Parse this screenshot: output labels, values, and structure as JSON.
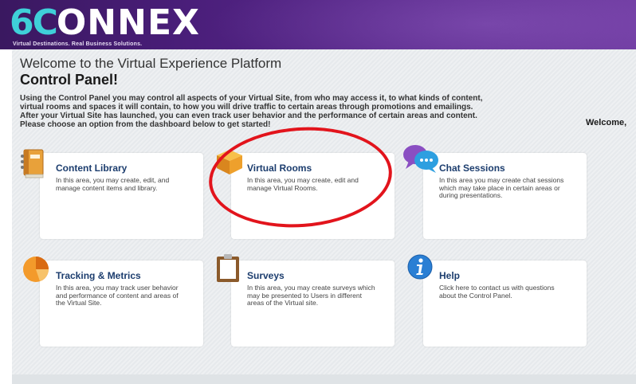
{
  "header": {
    "logo_six": "6C",
    "logo_word": "ONNEX",
    "tagline": "Virtual Destinations. Real Business Solutions."
  },
  "page": {
    "welcome_line": "Welcome to the Virtual Experience Platform",
    "title": "Control Panel!",
    "intro_lines": [
      "Using the Control Panel you may control all aspects of your Virtual Site, from who may access it, to what kinds of content,",
      "virtual rooms and spaces it will contain, to how you will drive traffic to certain areas through promotions and emailings.",
      "After your Virtual Site has launched, you can even track user behavior and the performance of certain areas and content.",
      "Please choose an option from the dashboard below to get started!"
    ],
    "welcome_user": "Welcome,"
  },
  "cards": [
    {
      "title": "Content Library",
      "desc": "In this area, you may create, edit, and manage content items and library.",
      "icon": "book-icon"
    },
    {
      "title": "Virtual Rooms",
      "desc": "In this area, you may create, edit and manage Virtual Rooms.",
      "icon": "cube-icon"
    },
    {
      "title": "Chat Sessions",
      "desc": "In this area you may create chat sessions which may take place in certain areas or during presentations.",
      "icon": "chat-bubbles-icon"
    },
    {
      "title": "Tracking & Metrics",
      "desc": "In this area, you may track user behavior and performance of content and areas of the Virtual Site.",
      "icon": "pie-chart-icon"
    },
    {
      "title": "Surveys",
      "desc": "In this area, you may create surveys which may be presented to Users in different areas of the Virtual site.",
      "icon": "clipboard-icon"
    },
    {
      "title": "Help",
      "desc": "Click here to contact us with questions about the Control Panel.",
      "icon": "info-icon"
    }
  ],
  "colors": {
    "header_purple": "#4a1e7a",
    "logo_cyan": "#3fd0d8",
    "card_title_blue": "#1c3d6e",
    "annotation_red": "#e2141c"
  }
}
